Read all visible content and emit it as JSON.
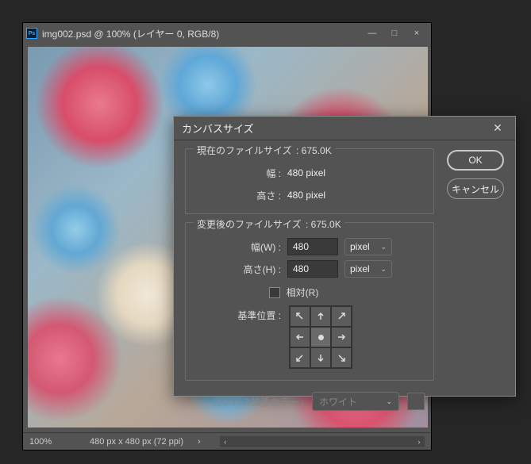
{
  "doc_window": {
    "title": "img002.psd @ 100% (レイヤー 0, RGB/8)",
    "minimize": "—",
    "maximize": "□",
    "close": "×"
  },
  "status_bar": {
    "zoom": "100%",
    "dimensions": "480 px x 480 px (72 ppi)"
  },
  "dialog": {
    "title": "カンバスサイズ",
    "close": "✕",
    "ok": "OK",
    "cancel": "キャンセル",
    "current_size": {
      "legend_label": "現在のファイルサイズ",
      "legend_value": "675.0K",
      "width_label": "幅 :",
      "width_value": "480 pixel",
      "height_label": "高さ :",
      "height_value": "480 pixel"
    },
    "new_size": {
      "legend_label": "変更後のファイルサイズ",
      "legend_value": "675.0K",
      "width_label": "幅(W) :",
      "width_value": "480",
      "width_unit": "pixel",
      "height_label": "高さ(H) :",
      "height_value": "480",
      "height_unit": "pixel",
      "relative_label": "相対(R)",
      "anchor_label": "基準位置 :"
    },
    "extension": {
      "label": "カンバス拡張カラー :",
      "value": "ホワイト"
    }
  }
}
